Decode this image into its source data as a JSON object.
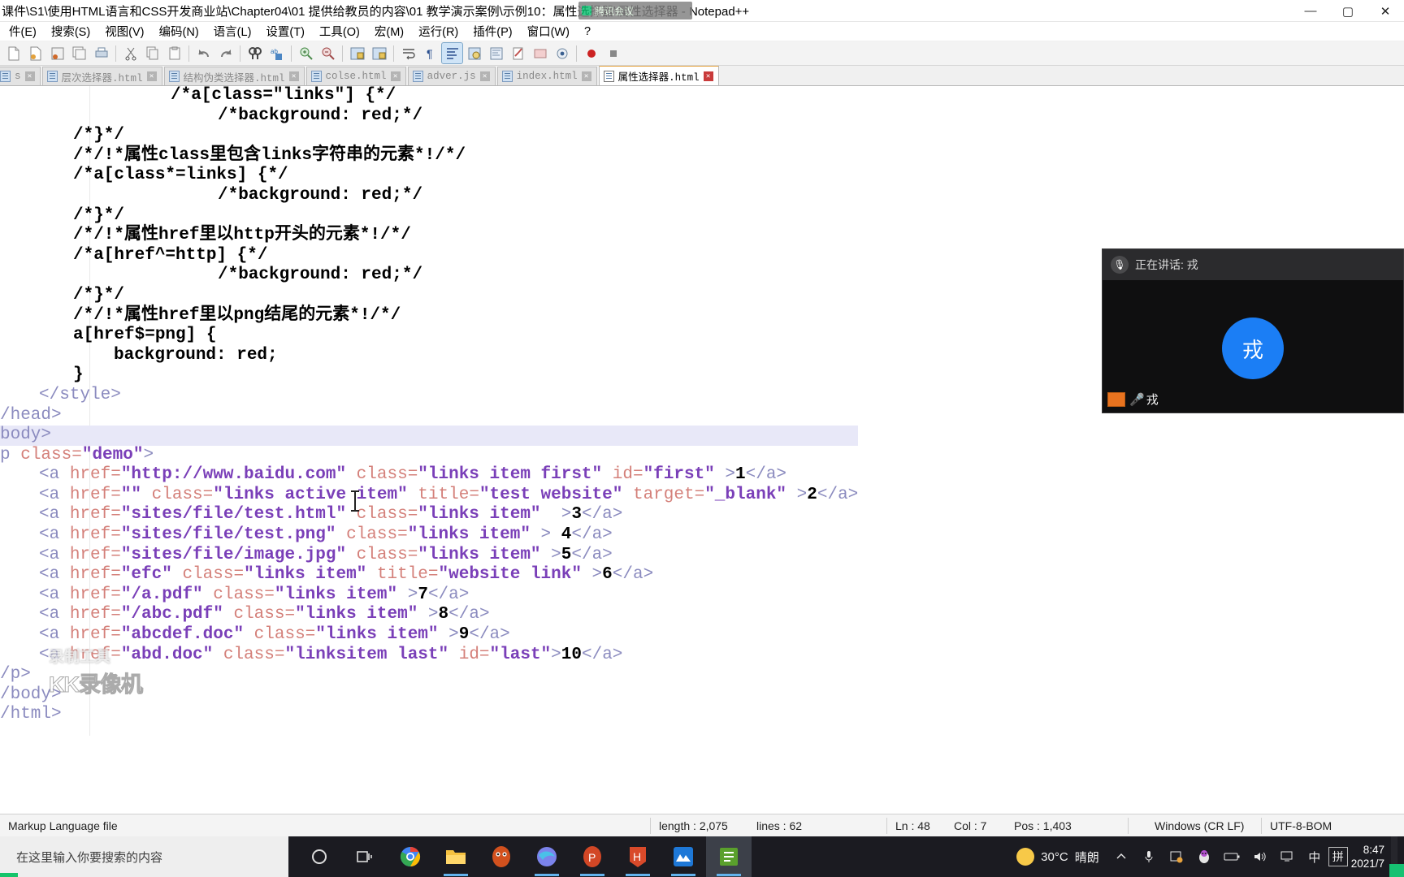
{
  "window": {
    "title": "课件\\S1\\使用HTML语言和CSS开发商业站\\Chapter04\\01 提供给教员的内容\\01 教学演示案例\\示例10：属性选择器\\属性选择器 - Notepad++",
    "overlay_chip": "腾讯会议",
    "minimize": "—",
    "maximize": "▢",
    "close": "✕"
  },
  "menu": {
    "items": [
      {
        "label": "件(E)"
      },
      {
        "label": "搜索(S)"
      },
      {
        "label": "视图(V)"
      },
      {
        "label": "编码(N)"
      },
      {
        "label": "语言(L)"
      },
      {
        "label": "设置(T)"
      },
      {
        "label": "工具(O)"
      },
      {
        "label": "宏(M)"
      },
      {
        "label": "运行(R)"
      },
      {
        "label": "插件(P)"
      },
      {
        "label": "窗口(W)"
      },
      {
        "label": "?"
      }
    ]
  },
  "toolbar": {
    "buttons": [
      {
        "name": "new-file-icon"
      },
      {
        "name": "open-file-icon"
      },
      {
        "name": "save-file-icon"
      },
      {
        "name": "save-all-icon"
      },
      {
        "name": "print-icon"
      },
      {
        "name": "cut-icon"
      },
      {
        "name": "copy-icon"
      },
      {
        "name": "paste-icon"
      },
      {
        "name": "undo-icon"
      },
      {
        "name": "redo-icon"
      },
      {
        "name": "find-icon"
      },
      {
        "name": "replace-icon"
      },
      {
        "name": "zoom-in-icon"
      },
      {
        "name": "zoom-out-icon"
      },
      {
        "name": "sync-vertical-icon"
      },
      {
        "name": "sync-horizontal-icon"
      },
      {
        "name": "word-wrap-icon"
      },
      {
        "name": "show-all-chars-icon"
      },
      {
        "name": "indent-guide-icon"
      },
      {
        "name": "user-define-dialog-icon"
      },
      {
        "name": "show-doc-map-icon"
      },
      {
        "name": "function-list-icon"
      },
      {
        "name": "folder-as-workspace-icon"
      },
      {
        "name": "monitoring-icon"
      },
      {
        "name": "record-macro-icon"
      },
      {
        "name": "stop-macro-icon"
      }
    ]
  },
  "tabs": [
    {
      "label": "s",
      "active": false,
      "clipped": true
    },
    {
      "label": "层次选择器.html",
      "active": false
    },
    {
      "label": "结构伪类选择器.html",
      "active": false
    },
    {
      "label": "colse.html",
      "active": false
    },
    {
      "label": "adver.js",
      "active": false
    },
    {
      "label": "index.html",
      "active": false
    },
    {
      "label": "属性选择器.html",
      "active": true
    }
  ],
  "editor": {
    "lines": [
      {
        "indent": 210,
        "segments": [
          {
            "t": "/*a[class=\"links\"] {*/",
            "c": "c-cmt"
          }
        ]
      },
      {
        "indent": 268,
        "segments": [
          {
            "t": "/*background: red;*/",
            "c": "c-cmt"
          }
        ]
      },
      {
        "indent": 90,
        "segments": [
          {
            "t": "/*}*/",
            "c": "c-cmt"
          }
        ]
      },
      {
        "indent": 90,
        "segments": [
          {
            "t": "/*/!*属性class里包含links字符串的元素*!/*/",
            "c": "c-cmt"
          }
        ]
      },
      {
        "indent": 90,
        "segments": [
          {
            "t": "/*a[class*=links] {*/",
            "c": "c-cmt"
          }
        ]
      },
      {
        "indent": 268,
        "segments": [
          {
            "t": "/*background: red;*/",
            "c": "c-cmt"
          }
        ]
      },
      {
        "indent": 90,
        "segments": [
          {
            "t": "/*}*/",
            "c": "c-cmt"
          }
        ]
      },
      {
        "indent": 90,
        "segments": [
          {
            "t": "/*/!*属性href里以http开头的元素*!/*/",
            "c": "c-cmt"
          }
        ]
      },
      {
        "indent": 90,
        "segments": [
          {
            "t": "/*a[href^=http] {*/",
            "c": "c-cmt"
          }
        ]
      },
      {
        "indent": 268,
        "segments": [
          {
            "t": "/*background: red;*/",
            "c": "c-cmt"
          }
        ]
      },
      {
        "indent": 90,
        "segments": [
          {
            "t": "/*}*/",
            "c": "c-cmt"
          }
        ]
      },
      {
        "indent": 90,
        "segments": [
          {
            "t": "/*/!*属性href里以png结尾的元素*!/*/",
            "c": "c-cmt"
          }
        ]
      },
      {
        "indent": 90,
        "segments": [
          {
            "t": "a[href$=png] {",
            "c": "c-txt"
          }
        ]
      },
      {
        "indent": 140,
        "segments": [
          {
            "t": "background: red;",
            "c": "c-txt"
          }
        ]
      },
      {
        "indent": 90,
        "segments": [
          {
            "t": "}",
            "c": "c-txt"
          }
        ]
      },
      {
        "indent": 48,
        "segments": [
          {
            "t": "</style>",
            "c": "c-tagd"
          }
        ]
      },
      {
        "indent": 0,
        "segments": [
          {
            "t": "/head>",
            "c": "c-tagd"
          }
        ]
      },
      {
        "indent": 0,
        "highlight": true,
        "segments": [
          {
            "t": "body>",
            "c": "c-tagd"
          }
        ]
      },
      {
        "indent": 0,
        "segments": [
          {
            "t": "p ",
            "c": "c-tagd"
          },
          {
            "t": "class=",
            "c": "c-attr"
          },
          {
            "t": "\"demo\"",
            "c": "c-val"
          },
          {
            "t": ">",
            "c": "c-tagd"
          }
        ]
      },
      {
        "indent": 48,
        "segments": [
          {
            "t": "<a ",
            "c": "c-tagd"
          },
          {
            "t": "href=",
            "c": "c-attr"
          },
          {
            "t": "\"http://www.baidu.com\"",
            "c": "c-val"
          },
          {
            "t": " class=",
            "c": "c-attr"
          },
          {
            "t": "\"links item first\"",
            "c": "c-val"
          },
          {
            "t": " id=",
            "c": "c-attr"
          },
          {
            "t": "\"first\"",
            "c": "c-val"
          },
          {
            "t": " >",
            "c": "c-tagd"
          },
          {
            "t": "1",
            "c": "c-txt"
          },
          {
            "t": "</a>",
            "c": "c-tagd"
          }
        ]
      },
      {
        "indent": 48,
        "segments": [
          {
            "t": "<a ",
            "c": "c-tagd"
          },
          {
            "t": "href=",
            "c": "c-attr"
          },
          {
            "t": "\"\"",
            "c": "c-val"
          },
          {
            "t": " class=",
            "c": "c-attr"
          },
          {
            "t": "\"links active item\"",
            "c": "c-val"
          },
          {
            "t": " title=",
            "c": "c-attr"
          },
          {
            "t": "\"test website\"",
            "c": "c-val"
          },
          {
            "t": " target=",
            "c": "c-attr"
          },
          {
            "t": "\"_blank\"",
            "c": "c-val"
          },
          {
            "t": " >",
            "c": "c-tagd"
          },
          {
            "t": "2",
            "c": "c-txt"
          },
          {
            "t": "</a>",
            "c": "c-tagd"
          }
        ]
      },
      {
        "indent": 48,
        "segments": [
          {
            "t": "<a ",
            "c": "c-tagd"
          },
          {
            "t": "href=",
            "c": "c-attr"
          },
          {
            "t": "\"sites/file/test.html\"",
            "c": "c-val"
          },
          {
            "t": " class=",
            "c": "c-attr"
          },
          {
            "t": "\"links item\"",
            "c": "c-val"
          },
          {
            "t": "  >",
            "c": "c-tagd"
          },
          {
            "t": "3",
            "c": "c-txt"
          },
          {
            "t": "</a>",
            "c": "c-tagd"
          }
        ]
      },
      {
        "indent": 48,
        "segments": [
          {
            "t": "<a ",
            "c": "c-tagd"
          },
          {
            "t": "href=",
            "c": "c-attr"
          },
          {
            "t": "\"sites/file/test.png\"",
            "c": "c-val"
          },
          {
            "t": " class=",
            "c": "c-attr"
          },
          {
            "t": "\"links item\"",
            "c": "c-val"
          },
          {
            "t": " > ",
            "c": "c-tagd"
          },
          {
            "t": "4",
            "c": "c-txt"
          },
          {
            "t": "</a>",
            "c": "c-tagd"
          }
        ]
      },
      {
        "indent": 48,
        "segments": [
          {
            "t": "<a ",
            "c": "c-tagd"
          },
          {
            "t": "href=",
            "c": "c-attr"
          },
          {
            "t": "\"sites/file/image.jpg\"",
            "c": "c-val"
          },
          {
            "t": " class=",
            "c": "c-attr"
          },
          {
            "t": "\"links item\"",
            "c": "c-val"
          },
          {
            "t": " >",
            "c": "c-tagd"
          },
          {
            "t": "5",
            "c": "c-txt"
          },
          {
            "t": "</a>",
            "c": "c-tagd"
          }
        ]
      },
      {
        "indent": 48,
        "segments": [
          {
            "t": "<a ",
            "c": "c-tagd"
          },
          {
            "t": "href=",
            "c": "c-attr"
          },
          {
            "t": "\"efc\"",
            "c": "c-val"
          },
          {
            "t": " class=",
            "c": "c-attr"
          },
          {
            "t": "\"links item\"",
            "c": "c-val"
          },
          {
            "t": " title=",
            "c": "c-attr"
          },
          {
            "t": "\"website link\"",
            "c": "c-val"
          },
          {
            "t": " >",
            "c": "c-tagd"
          },
          {
            "t": "6",
            "c": "c-txt"
          },
          {
            "t": "</a>",
            "c": "c-tagd"
          }
        ]
      },
      {
        "indent": 48,
        "segments": [
          {
            "t": "<a ",
            "c": "c-tagd"
          },
          {
            "t": "href=",
            "c": "c-attr"
          },
          {
            "t": "\"/a.pdf\"",
            "c": "c-val"
          },
          {
            "t": " class=",
            "c": "c-attr"
          },
          {
            "t": "\"links item\"",
            "c": "c-val"
          },
          {
            "t": " >",
            "c": "c-tagd"
          },
          {
            "t": "7",
            "c": "c-txt"
          },
          {
            "t": "</a>",
            "c": "c-tagd"
          }
        ]
      },
      {
        "indent": 48,
        "segments": [
          {
            "t": "<a ",
            "c": "c-tagd"
          },
          {
            "t": "href=",
            "c": "c-attr"
          },
          {
            "t": "\"/abc.pdf\"",
            "c": "c-val"
          },
          {
            "t": " class=",
            "c": "c-attr"
          },
          {
            "t": "\"links item\"",
            "c": "c-val"
          },
          {
            "t": " >",
            "c": "c-tagd"
          },
          {
            "t": "8",
            "c": "c-txt"
          },
          {
            "t": "</a>",
            "c": "c-tagd"
          }
        ]
      },
      {
        "indent": 48,
        "segments": [
          {
            "t": "<a ",
            "c": "c-tagd"
          },
          {
            "t": "href=",
            "c": "c-attr"
          },
          {
            "t": "\"abcdef.doc\"",
            "c": "c-val"
          },
          {
            "t": " class=",
            "c": "c-attr"
          },
          {
            "t": "\"links item\"",
            "c": "c-val"
          },
          {
            "t": " >",
            "c": "c-tagd"
          },
          {
            "t": "9",
            "c": "c-txt"
          },
          {
            "t": "</a>",
            "c": "c-tagd"
          }
        ]
      },
      {
        "indent": 48,
        "segments": [
          {
            "t": "<a ",
            "c": "c-tagd"
          },
          {
            "t": "href=",
            "c": "c-attr"
          },
          {
            "t": "\"abd.doc\"",
            "c": "c-val"
          },
          {
            "t": " class=",
            "c": "c-attr"
          },
          {
            "t": "\"linksitem last\"",
            "c": "c-val"
          },
          {
            "t": " id=",
            "c": "c-attr"
          },
          {
            "t": "\"last\"",
            "c": "c-val"
          },
          {
            "t": ">",
            "c": "c-tagd"
          },
          {
            "t": "10",
            "c": "c-txt"
          },
          {
            "t": "</a>",
            "c": "c-tagd"
          }
        ]
      },
      {
        "indent": 0,
        "segments": [
          {
            "t": "/p>",
            "c": "c-tagd"
          }
        ]
      },
      {
        "indent": 0,
        "segments": [
          {
            "t": "/body>",
            "c": "c-tagd"
          }
        ]
      },
      {
        "indent": 0,
        "segments": [
          {
            "t": "/html>",
            "c": "c-tagd"
          }
        ]
      }
    ]
  },
  "meeting": {
    "speaking_label": "正在讲话: 戎",
    "avatar_initial": "戎",
    "participant_name": "戎",
    "mic_icon": "mic-icon"
  },
  "watermark": {
    "top": "录制工具",
    "main": "KK录像机"
  },
  "statusbar": {
    "file_type": "Markup Language file",
    "length_label": "length : 2,075",
    "lines_label": "lines : 62",
    "ln": "Ln : 48",
    "col": "Col : 7",
    "pos": "Pos : 1,403",
    "eol": "Windows (CR LF)",
    "encoding": "UTF-8-BOM"
  },
  "taskbar": {
    "search_placeholder": "在这里输入你要搜索的内容",
    "apps": [
      {
        "name": "cortana-icon"
      },
      {
        "name": "task-view-icon"
      },
      {
        "name": "chrome-icon"
      },
      {
        "name": "file-explorer-icon"
      },
      {
        "name": "foxmail-icon"
      },
      {
        "name": "edge-icon"
      },
      {
        "name": "powerpoint-icon"
      },
      {
        "name": "hbuilder-icon"
      },
      {
        "name": "xmind-icon"
      },
      {
        "name": "notepadpp-icon"
      }
    ],
    "weather_temp": "30°C",
    "weather_desc": "晴朗",
    "tray": [
      {
        "name": "chevron-up-icon",
        "glyph": "︿"
      },
      {
        "name": "microphone-icon",
        "glyph": "🎤"
      },
      {
        "name": "screenshot-icon",
        "glyph": "▣"
      },
      {
        "name": "qq-icon",
        "glyph": "🐧"
      },
      {
        "name": "battery-icon",
        "glyph": "▭"
      },
      {
        "name": "volume-icon",
        "glyph": "🔊"
      },
      {
        "name": "network-icon",
        "glyph": "🖵"
      },
      {
        "name": "ime-chinese-icon",
        "glyph": "中"
      },
      {
        "name": "ime-pinyin-icon",
        "glyph": "拼"
      }
    ],
    "time": "8:47",
    "date": "2021/7"
  }
}
